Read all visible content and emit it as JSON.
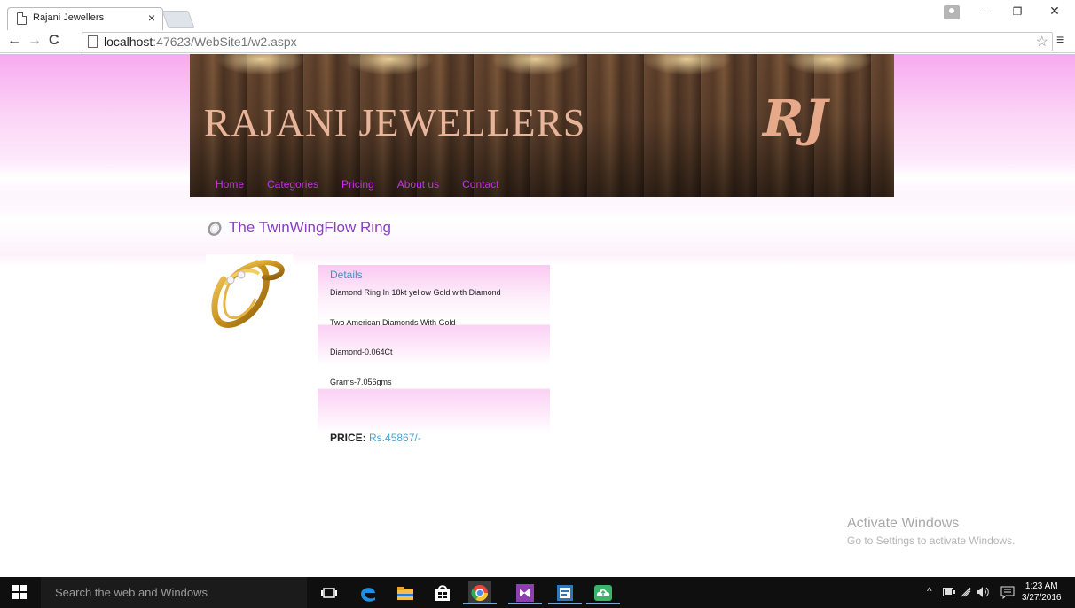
{
  "browser": {
    "tab_title": "Rajani Jewellers",
    "tab_close": "×",
    "url_host": "localhost",
    "url_rest": ":47623/WebSite1/w2.aspx",
    "back": "←",
    "forward": "→",
    "reload": "C",
    "star": "☆",
    "menu": "≡",
    "window_controls": {
      "minimize": "–",
      "restore": "❐",
      "close": "✕"
    }
  },
  "site": {
    "brand": "RAJANI JEWELLERS",
    "monogram": "RJ",
    "nav": [
      "Home",
      "Categories",
      "Pricing",
      "About us",
      "Contact"
    ]
  },
  "product": {
    "title": "The TwinWingFlow Ring",
    "details_heading": "Details",
    "details": [
      "Diamond Ring In 18kt yellow Gold with Diamond",
      "Two American Diamonds With Gold",
      "Diamond-0.064Ct",
      "Grams-7.056gms"
    ],
    "price_label": "PRICE:",
    "price_value": "Rs.45867/-"
  },
  "watermark": {
    "line1": "Activate Windows",
    "line2": "Go to Settings to activate Windows."
  },
  "taskbar": {
    "search_placeholder": "Search the web and Windows",
    "time": "1:23 AM",
    "date": "3/27/2016",
    "tray_chevron": "^"
  },
  "colors": {
    "nav_link": "#c431e0",
    "title": "#8b3ec4",
    "price_value": "#4aa3d8",
    "brand": "#e8b59b"
  }
}
